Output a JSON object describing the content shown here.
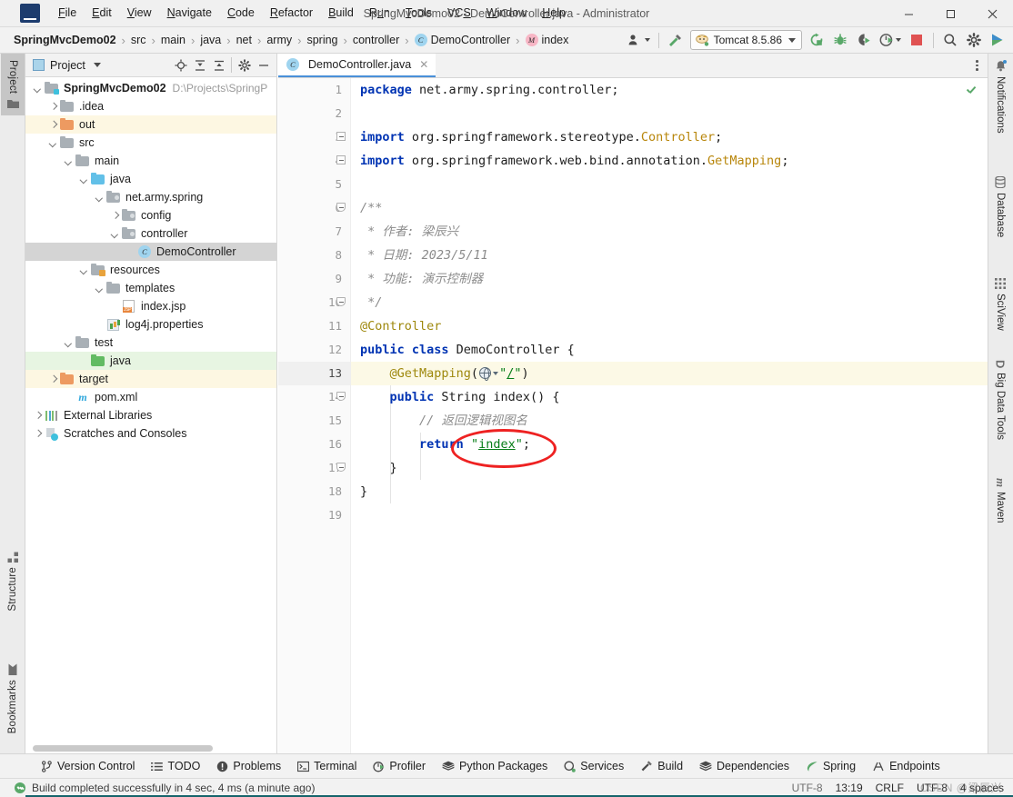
{
  "window": {
    "title": "SpringMvcDemo02 - DemoController.java - Administrator",
    "minimize": "─",
    "maximize": "☐",
    "close": "✕",
    "logo_letter": "IJ"
  },
  "menubar": {
    "items": [
      {
        "pre": "",
        "mn": "F",
        "post": "ile"
      },
      {
        "pre": "",
        "mn": "E",
        "post": "dit"
      },
      {
        "pre": "",
        "mn": "V",
        "post": "iew"
      },
      {
        "pre": "",
        "mn": "N",
        "post": "avigate"
      },
      {
        "pre": "",
        "mn": "C",
        "post": "ode"
      },
      {
        "pre": "",
        "mn": "R",
        "post": "efactor"
      },
      {
        "pre": "",
        "mn": "B",
        "post": "uild"
      },
      {
        "pre": "R",
        "mn": "u",
        "post": "n"
      },
      {
        "pre": "",
        "mn": "T",
        "post": "ools"
      },
      {
        "pre": "VC",
        "mn": "S",
        "post": ""
      },
      {
        "pre": "",
        "mn": "W",
        "post": "indow"
      },
      {
        "pre": "",
        "mn": "H",
        "post": "elp"
      }
    ]
  },
  "breadcrumb": {
    "separator": "›",
    "items": [
      {
        "label": "SpringMvcDemo02",
        "bold": true,
        "icon": ""
      },
      {
        "label": "src",
        "bold": false,
        "icon": ""
      },
      {
        "label": "main",
        "bold": false,
        "icon": ""
      },
      {
        "label": "java",
        "bold": false,
        "icon": ""
      },
      {
        "label": "net",
        "bold": false,
        "icon": ""
      },
      {
        "label": "army",
        "bold": false,
        "icon": ""
      },
      {
        "label": "spring",
        "bold": false,
        "icon": ""
      },
      {
        "label": "controller",
        "bold": false,
        "icon": ""
      },
      {
        "label": "DemoController",
        "bold": false,
        "icon": "c"
      },
      {
        "label": "index",
        "bold": false,
        "icon": "m"
      }
    ]
  },
  "toolbar": {
    "run_config": "Tomcat 8.5.86",
    "icons": [
      "user-settings-icon",
      "build-hammer-icon",
      "rerun-icon",
      "debug-icon",
      "run-with-coverage-icon",
      "profile-run-icon",
      "stop-icon",
      "search-everywhere-icon",
      "settings-gear-icon",
      "updates-icon"
    ]
  },
  "left_stripe": {
    "tabs": [
      {
        "label": "Project",
        "icon": "project-folder-icon",
        "active": true
      },
      {
        "label": "Structure",
        "icon": "structure-icon",
        "active": false
      },
      {
        "label": "Bookmarks",
        "icon": "bookmark-icon",
        "active": false
      }
    ]
  },
  "right_stripe": {
    "tabs": [
      {
        "label": "Notifications",
        "icon": "bell-icon"
      },
      {
        "label": "Database",
        "icon": "database-icon"
      },
      {
        "label": "SciView",
        "icon": "sciview-grid-icon"
      },
      {
        "label": "Big Data Tools",
        "icon": "big-data-d-icon"
      },
      {
        "label": "Maven",
        "icon": "maven-m-icon"
      }
    ]
  },
  "project_panel": {
    "title": "Project",
    "title_icon": "project-view-icon",
    "actions": [
      "locate-target-icon",
      "expand-all-icon",
      "collapse-all-icon",
      "settings-gear-icon",
      "hide-icon"
    ],
    "tree": [
      {
        "indent": 0,
        "arrow": "down",
        "icon": "folder-module",
        "label": "SpringMvcDemo02",
        "bold": true,
        "path": "D:\\Projects\\SpringP",
        "state": "none"
      },
      {
        "indent": 1,
        "arrow": "right",
        "icon": "folder-grey",
        "label": ".idea",
        "bold": false,
        "path": "",
        "state": "none"
      },
      {
        "indent": 1,
        "arrow": "right",
        "icon": "folder-orange",
        "label": "out",
        "bold": false,
        "path": "",
        "state": "yellow"
      },
      {
        "indent": 1,
        "arrow": "down",
        "icon": "folder-grey",
        "label": "src",
        "bold": false,
        "path": "",
        "state": "none"
      },
      {
        "indent": 2,
        "arrow": "down",
        "icon": "folder-grey",
        "label": "main",
        "bold": false,
        "path": "",
        "state": "none"
      },
      {
        "indent": 3,
        "arrow": "down",
        "icon": "folder-blue",
        "label": "java",
        "bold": false,
        "path": "",
        "state": "none"
      },
      {
        "indent": 4,
        "arrow": "down",
        "icon": "folder-package",
        "label": "net.army.spring",
        "bold": false,
        "path": "",
        "state": "none"
      },
      {
        "indent": 5,
        "arrow": "right",
        "icon": "folder-package",
        "label": "config",
        "bold": false,
        "path": "",
        "state": "none"
      },
      {
        "indent": 5,
        "arrow": "down",
        "icon": "folder-package",
        "label": "controller",
        "bold": false,
        "path": "",
        "state": "none"
      },
      {
        "indent": 6,
        "arrow": "none",
        "icon": "class-icon",
        "label": "DemoController",
        "bold": false,
        "path": "",
        "state": "selected"
      },
      {
        "indent": 3,
        "arrow": "down",
        "icon": "folder-resource",
        "label": "resources",
        "bold": false,
        "path": "",
        "state": "none"
      },
      {
        "indent": 4,
        "arrow": "down",
        "icon": "folder-grey",
        "label": "templates",
        "bold": false,
        "path": "",
        "state": "none"
      },
      {
        "indent": 5,
        "arrow": "none",
        "icon": "jsp-icon",
        "label": "index.jsp",
        "bold": false,
        "path": "",
        "state": "none"
      },
      {
        "indent": 4,
        "arrow": "none",
        "icon": "properties-icon",
        "label": "log4j.properties",
        "bold": false,
        "path": "",
        "state": "none"
      },
      {
        "indent": 2,
        "arrow": "down",
        "icon": "folder-grey",
        "label": "test",
        "bold": false,
        "path": "",
        "state": "none"
      },
      {
        "indent": 3,
        "arrow": "none",
        "icon": "folder-green",
        "label": "java",
        "bold": false,
        "path": "",
        "state": "green"
      },
      {
        "indent": 1,
        "arrow": "right",
        "icon": "folder-orange",
        "label": "target",
        "bold": false,
        "path": "",
        "state": "yellow"
      },
      {
        "indent": 2,
        "arrow": "none",
        "icon": "maven-icon",
        "label": "pom.xml",
        "bold": false,
        "path": "",
        "state": "none"
      },
      {
        "indent": 0,
        "arrow": "right",
        "icon": "libraries-icon",
        "label": "External Libraries",
        "bold": false,
        "path": "",
        "state": "none"
      },
      {
        "indent": 0,
        "arrow": "right",
        "icon": "scratches-icon",
        "label": "Scratches and Consoles",
        "bold": false,
        "path": "",
        "state": "none"
      }
    ]
  },
  "editor": {
    "tab": {
      "label": "DemoController.java",
      "icon": "java-class-icon",
      "close": "✕"
    },
    "inspection_status": "ok",
    "current_line": 13,
    "lines": [
      {
        "n": 1,
        "fold": "",
        "tokens": [
          {
            "t": "kw",
            "v": "package"
          },
          {
            "t": "pln",
            "v": " net.army.spring.controller;"
          }
        ]
      },
      {
        "n": 2,
        "fold": "",
        "tokens": []
      },
      {
        "n": 3,
        "fold": "minus",
        "tokens": [
          {
            "t": "kw",
            "v": "import"
          },
          {
            "t": "pln",
            "v": " org.springframework.stereotype."
          },
          {
            "t": "typ",
            "v": "Controller"
          },
          {
            "t": "pln",
            "v": ";"
          }
        ]
      },
      {
        "n": 4,
        "fold": "minus",
        "tokens": [
          {
            "t": "kw",
            "v": "import"
          },
          {
            "t": "pln",
            "v": " org.springframework.web.bind.annotation."
          },
          {
            "t": "typ",
            "v": "GetMapping"
          },
          {
            "t": "pln",
            "v": ";"
          }
        ]
      },
      {
        "n": 5,
        "fold": "",
        "tokens": []
      },
      {
        "n": 6,
        "fold": "tag",
        "tokens": [
          {
            "t": "cmt",
            "v": "/**"
          }
        ]
      },
      {
        "n": 7,
        "fold": "",
        "tokens": [
          {
            "t": "cmt",
            "v": " * 作者: 梁辰兴"
          }
        ]
      },
      {
        "n": 8,
        "fold": "",
        "tokens": [
          {
            "t": "cmt",
            "v": " * 日期: 2023/5/11"
          }
        ]
      },
      {
        "n": 9,
        "fold": "",
        "tokens": [
          {
            "t": "cmt",
            "v": " * 功能: 演示控制器"
          }
        ]
      },
      {
        "n": 10,
        "fold": "tagEnd",
        "tokens": [
          {
            "t": "cmt",
            "v": " */"
          }
        ]
      },
      {
        "n": 11,
        "fold": "",
        "tokens": [
          {
            "t": "ann",
            "v": "@Controller"
          }
        ]
      },
      {
        "n": 12,
        "fold": "",
        "tokens": [
          {
            "t": "kw",
            "v": "public class"
          },
          {
            "t": "pln",
            "v": " DemoController {"
          }
        ]
      },
      {
        "n": 13,
        "fold": "",
        "tokens": [
          {
            "t": "pln",
            "v": "    "
          },
          {
            "t": "ann",
            "v": "@GetMapping"
          },
          {
            "t": "pln",
            "v": "("
          },
          {
            "t": "webicon",
            "v": ""
          },
          {
            "t": "str",
            "v": "\""
          },
          {
            "t": "strund",
            "v": "/"
          },
          {
            "t": "str",
            "v": "\""
          },
          {
            "t": "pln",
            "v": ")"
          }
        ]
      },
      {
        "n": 14,
        "fold": "tag",
        "tokens": [
          {
            "t": "pln",
            "v": "    "
          },
          {
            "t": "kw",
            "v": "public"
          },
          {
            "t": "pln",
            "v": " String "
          },
          {
            "t": "typ2",
            "v": "index"
          },
          {
            "t": "pln",
            "v": "() {"
          }
        ]
      },
      {
        "n": 15,
        "fold": "",
        "tokens": [
          {
            "t": "pln",
            "v": "        "
          },
          {
            "t": "cmt",
            "v": "// 返回逻辑视图名"
          }
        ]
      },
      {
        "n": 16,
        "fold": "",
        "tokens": [
          {
            "t": "pln",
            "v": "        "
          },
          {
            "t": "kw",
            "v": "return"
          },
          {
            "t": "pln",
            "v": " "
          },
          {
            "t": "str",
            "v": "\""
          },
          {
            "t": "strund",
            "v": "index"
          },
          {
            "t": "str",
            "v": "\""
          },
          {
            "t": "pln",
            "v": ";"
          }
        ]
      },
      {
        "n": 17,
        "fold": "tagEnd",
        "tokens": [
          {
            "t": "pln",
            "v": "    }"
          }
        ]
      },
      {
        "n": 18,
        "fold": "",
        "tokens": [
          {
            "t": "pln",
            "v": "}"
          }
        ]
      },
      {
        "n": 19,
        "fold": "",
        "tokens": []
      }
    ],
    "annotation": {
      "shape": "ellipse",
      "color": "#ee2222",
      "target": "@GetMapping(\"/\") argument"
    }
  },
  "tool_windows": [
    {
      "label": "Version Control",
      "icon": "branch-icon"
    },
    {
      "label": "TODO",
      "icon": "todo-list-icon"
    },
    {
      "label": "Problems",
      "icon": "problems-icon"
    },
    {
      "label": "Terminal",
      "icon": "terminal-icon"
    },
    {
      "label": "Profiler",
      "icon": "profiler-icon"
    },
    {
      "label": "Python Packages",
      "icon": "python-packages-icon"
    },
    {
      "label": "Services",
      "icon": "services-icon"
    },
    {
      "label": "Build",
      "icon": "build-hammer-icon"
    },
    {
      "label": "Dependencies",
      "icon": "dependencies-icon"
    },
    {
      "label": "Spring",
      "icon": "spring-leaf-icon"
    },
    {
      "label": "Endpoints",
      "icon": "endpoints-icon"
    }
  ],
  "statusbar": {
    "message": "Build completed successfully in 4 sec, 4 ms (a minute ago)",
    "status_icon": "success-check-icon",
    "encoding": "UTF-8",
    "time": "13:19",
    "line_separator": "CRLF",
    "file_encoding": "UTF-8",
    "indent": "4 spaces",
    "watermark": "CSDN @梁辰兴"
  },
  "colors": {
    "accent_blue": "#4a90d9",
    "annotation_red": "#ee2222",
    "success_green": "#59a869",
    "keyword_blue": "#0033b3",
    "string_green": "#067d17",
    "annotation_gold": "#9e880d",
    "selection_grey": "#d4d4d4",
    "current_line_yellow": "#fcf9e6"
  }
}
